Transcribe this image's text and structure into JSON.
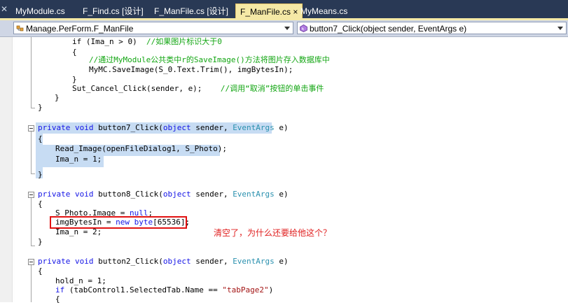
{
  "tabs": [
    {
      "label": "MyModule.cs"
    },
    {
      "label": "F_Find.cs [设计]"
    },
    {
      "label": "F_ManFile.cs [设计]"
    },
    {
      "label": "F_ManFile.cs",
      "close": "×"
    },
    {
      "label": "MyMeans.cs"
    }
  ],
  "nav": {
    "class_combo": "Manage.PerForm.F_ManFile",
    "member_combo": "button7_Click(object sender, EventArgs e)"
  },
  "code": {
    "l1": {
      "a": "if (Ima_n > 0)  ",
      "c": "//如果图片标识大于0"
    },
    "l2": "{",
    "l3": {
      "c": "//通过MyModule公共类中r的SaveImage()方法将图片存入数据库中"
    },
    "l4": "MyMC.SaveImage(S_0.Text.Trim(), imgBytesIn);",
    "l5": "}",
    "l6": {
      "a": "Sut_Cancel_Click(sender, e);    ",
      "c": "//调用“取消”按钮的单击事件"
    },
    "l7": "}",
    "l8": "}",
    "l9": {
      "k1": "private",
      "k2": "void",
      "a": "button7_Click(",
      "k3": "object",
      "b": "sender,",
      "t": "EventArgs",
      "e": "e)"
    },
    "l10": "{",
    "l11": "Read_Image(openFileDialog1, S_Photo);",
    "l12": "Ima_n = 1;",
    "l13": "}",
    "l14": {
      "k1": "private",
      "k2": "void",
      "a": "button8_Click(",
      "k3": "object",
      "b": "sender,",
      "t": "EventArgs",
      "e": "e)"
    },
    "l15": "{",
    "l16": {
      "a": "S_Photo.Image = ",
      "k": "null",
      "e": ";"
    },
    "l17": {
      "a": "imgBytesIn = ",
      "k": "new",
      "k2": "byte",
      "e": "[65536];"
    },
    "l18": "Ima_n = 2;",
    "l19": "}",
    "l20": {
      "k1": "private",
      "k2": "void",
      "a": "button2_Click(",
      "k3": "object",
      "b": "sender,",
      "t": "EventArgs",
      "e": "e)"
    },
    "l21": "{",
    "l22": "hold_n = 1;",
    "l23": {
      "k": "if",
      "a": " (tabControl1.SelectedTab.Name == ",
      "s": "\"tabPage2\"",
      "e": ")"
    },
    "l24": "{"
  },
  "annotation": "清空了，为什么还要给他这个？"
}
